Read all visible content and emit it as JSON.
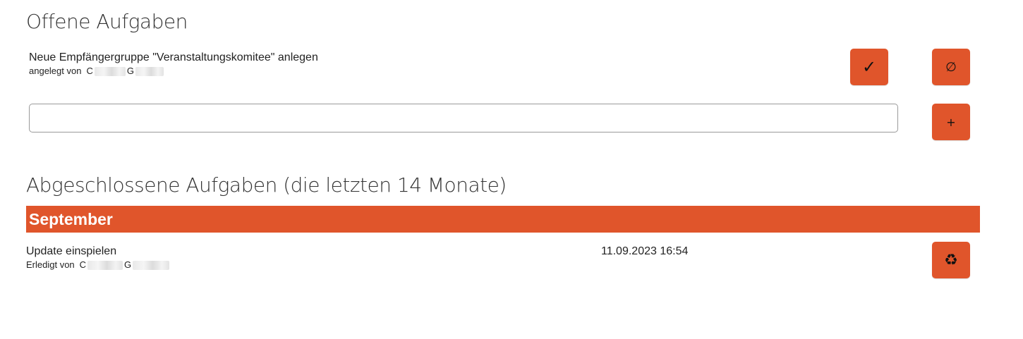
{
  "open_tasks": {
    "heading": "Offene Aufgaben",
    "items": [
      {
        "title": "Neue Empfängergruppe \"Veranstaltungskomitee\" anlegen",
        "meta_prefix": "angelegt von",
        "first_initial": "C",
        "last_initial": "G",
        "complete_icon": "✓",
        "delete_icon": "∅"
      }
    ],
    "new_task": {
      "value": "",
      "placeholder": "",
      "add_icon": "+"
    }
  },
  "completed_tasks": {
    "heading": "Abgeschlossene Aufgaben (die letzten 14 Monate)",
    "groups": [
      {
        "month": "September",
        "items": [
          {
            "title": "Update einspielen",
            "meta_prefix": "Erledigt von",
            "first_initial": "C",
            "last_initial": "G",
            "date": "11.09.2023 16:54",
            "restore_icon": "♻"
          }
        ]
      }
    ]
  },
  "colors": {
    "accent": "#e0552b",
    "text": "#222222",
    "heading": "#333333"
  }
}
